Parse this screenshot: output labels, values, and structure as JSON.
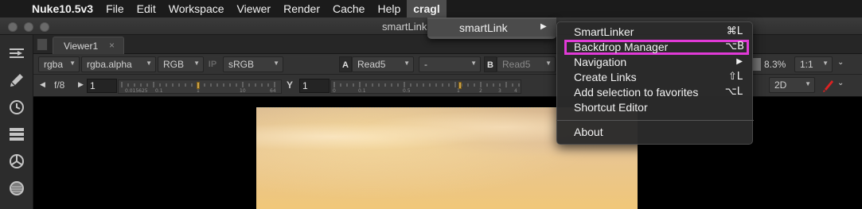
{
  "menubar": {
    "app_name": "Nuke10.5v3",
    "items": [
      "File",
      "Edit",
      "Workspace",
      "Viewer",
      "Render",
      "Cache",
      "Help",
      "cragl"
    ]
  },
  "window": {
    "title": "smartLink"
  },
  "viewer_tab": {
    "label": "Viewer1",
    "close": "×"
  },
  "toolbar": {
    "channels": "rgba",
    "alpha": "rgba.alpha",
    "display": "RGB",
    "ip": "IP",
    "lut": "sRGB",
    "input_a_label": "A",
    "input_a": "Read5",
    "operation": "-",
    "input_b_label": "B",
    "input_b": "Read5",
    "zoom": "8.3%",
    "proxy": "1:1",
    "view_mode": "2D"
  },
  "exposure_row": {
    "fstop_label": "f/8",
    "gain_value": "1",
    "gamma_label": "Y",
    "gamma_value": "1",
    "gain_ticks": [
      "0.015625",
      "0.1",
      "1",
      "10",
      "64"
    ],
    "gamma_ticks": [
      "0",
      "0.1",
      "0.5",
      "1",
      "2",
      "3",
      "4"
    ]
  },
  "cragl_menu": {
    "item": "smartLink",
    "arrow": "▶"
  },
  "submenu": {
    "items": [
      {
        "label": "SmartLinker",
        "shortcut": "⌘L"
      },
      {
        "label": "Backdrop Manager",
        "shortcut": "⌥B"
      },
      {
        "label": "Navigation",
        "shortcut": "▶"
      },
      {
        "label": "Create Links",
        "shortcut": "⇧L"
      },
      {
        "label": "Add selection to favorites",
        "shortcut": "⌥L"
      },
      {
        "label": "Shortcut Editor",
        "shortcut": ""
      },
      {
        "label": "About",
        "shortcut": ""
      }
    ]
  },
  "colors": {
    "highlight_outline": "#e03ad6",
    "gain_handle": "#caa24a"
  }
}
